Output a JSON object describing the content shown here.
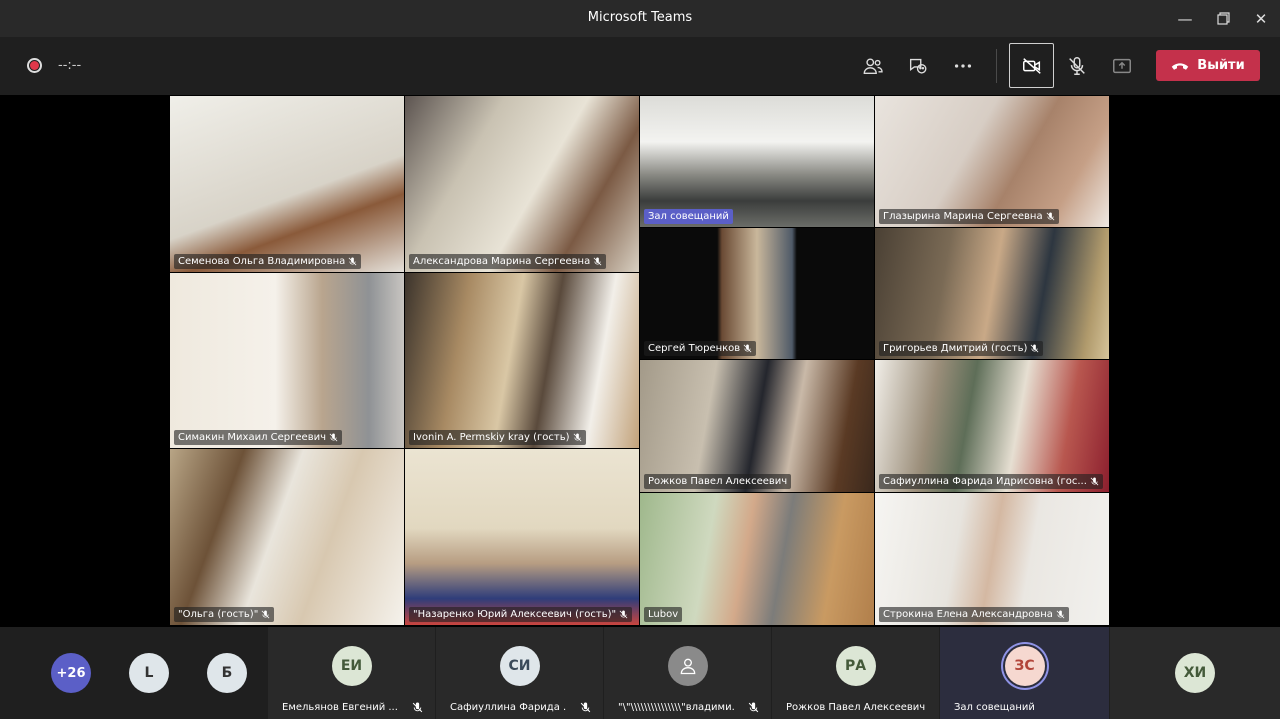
{
  "window": {
    "title": "Microsoft Teams"
  },
  "toolbar": {
    "timer": "--:--",
    "leave_label": "Выйти"
  },
  "tiles": [
    {
      "name": "Семенова Ольга Владимировна"
    },
    {
      "name": "Александрова Марина Сергеевна"
    },
    {
      "name": "Зал совещаний"
    },
    {
      "name": "Глазырина Марина Сергеевна"
    },
    {
      "name": "Сергей Тюренков"
    },
    {
      "name": "Григорьев Дмитрий (гость)"
    },
    {
      "name": "Симакин Михаил Сергеевич"
    },
    {
      "name": "Ivonin A. Permskiy kray (гость)"
    },
    {
      "name": "Рожков Павел Алексеевич"
    },
    {
      "name": "Сафиуллина Фарида Идрисовна (гос..."
    },
    {
      "name": "\"Ольга (гость)\""
    },
    {
      "name": "\"Назаренко Юрий Алексеевич (гость)\""
    },
    {
      "name": "Lubov"
    },
    {
      "name": "Строкина Елена Александровна"
    }
  ],
  "strip": {
    "overflow_count": "+26",
    "avatars": [
      {
        "initials": "L"
      },
      {
        "initials": "Б"
      },
      {
        "initials": "ЕИ",
        "name": "Емельянов Евгений ..."
      },
      {
        "initials": "СИ",
        "name": "Сафиуллина Фарида ..."
      },
      {
        "initials": "",
        "name": "\"\\\"\\\\\\\\\\\\\\\\\\\\\\\\\\\\\\\"владими..."
      },
      {
        "initials": "РА",
        "name": "Рожков Павел Алексеевич"
      },
      {
        "initials": "ЗС",
        "name": "Зал совещаний"
      },
      {
        "initials": "ХИ"
      }
    ]
  },
  "colors": {
    "accent": "#5b5fc7",
    "leave": "#c4314b",
    "avatar_bg": "#dce6d5",
    "avatar_text": "#445a3a",
    "active_avatar_bg": "#f6d8d0",
    "active_avatar_text": "#b2453a"
  }
}
